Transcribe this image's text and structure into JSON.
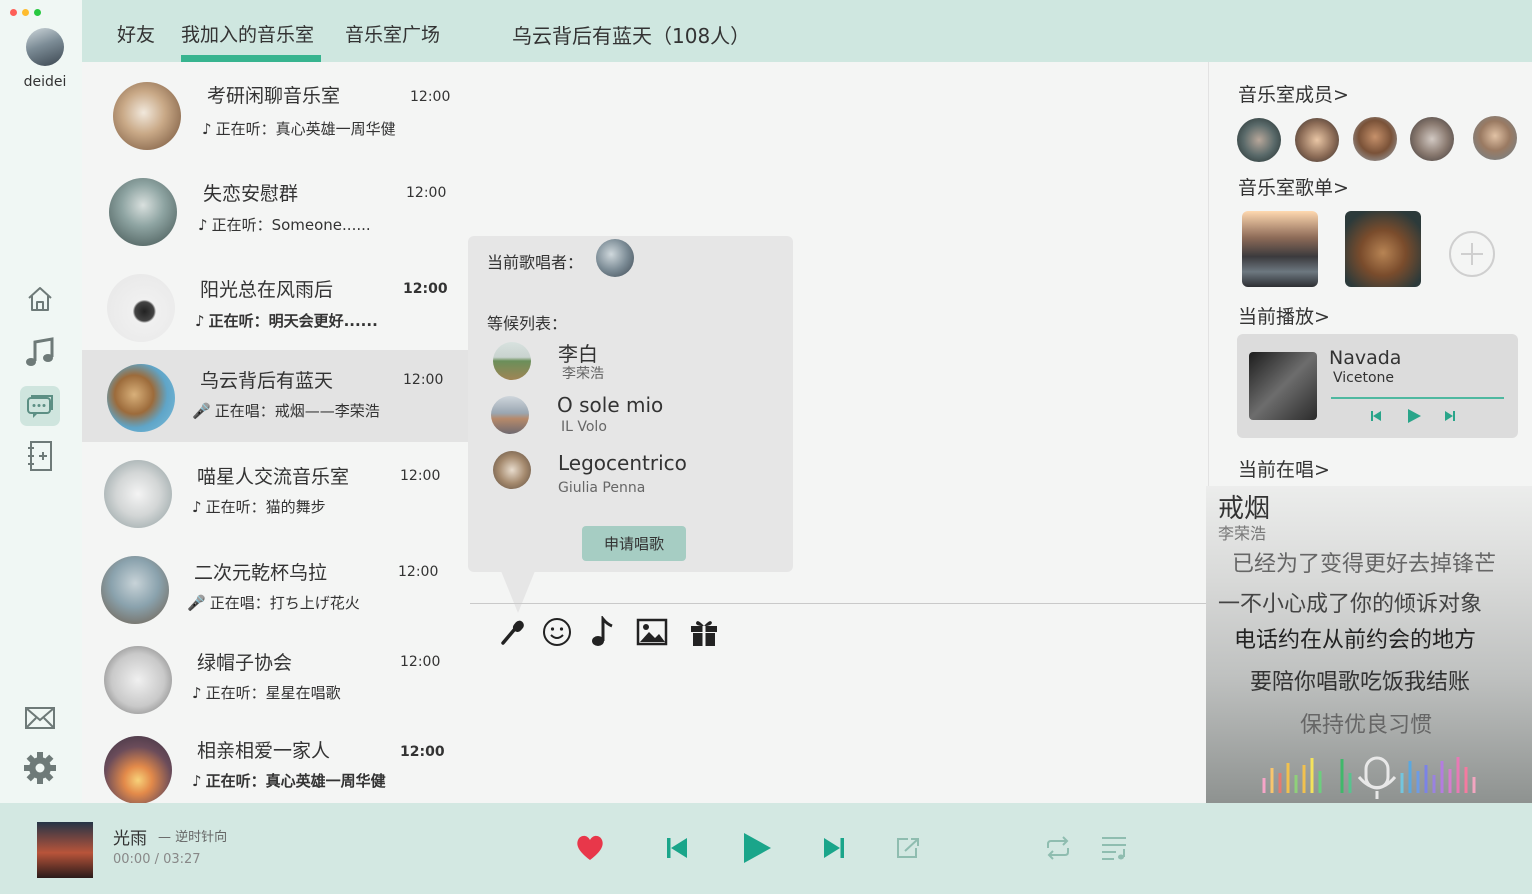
{
  "user": {
    "name": "deidei"
  },
  "tabs": {
    "friends": "好友",
    "joined": "我加入的音乐室",
    "plaza": "音乐室广场"
  },
  "room_title": "乌云背后有蓝天（108人）",
  "rooms": [
    {
      "name": "考研闲聊音乐室",
      "time": "12:00",
      "status": "正在听：真心英雄一周华健",
      "mode": "listen"
    },
    {
      "name": "失恋安慰群",
      "time": "12:00",
      "status": "正在听：Someone......",
      "mode": "listen"
    },
    {
      "name": "阳光总在风雨后",
      "time": "12:00",
      "status": "正在听：明天会更好......",
      "mode": "listen"
    },
    {
      "name": "乌云背后有蓝天",
      "time": "12:00",
      "status": "正在唱：戒烟——李荣浩",
      "mode": "sing"
    },
    {
      "name": "喵星人交流音乐室",
      "time": "12:00",
      "status": "正在听：猫的舞步",
      "mode": "listen"
    },
    {
      "name": "二次元乾杯乌拉",
      "time": "12:00",
      "status": "正在唱：打ち上げ花火",
      "mode": "sing"
    },
    {
      "name": "绿帽子协会",
      "time": "12:00",
      "status": "正在听：星星在唱歌",
      "mode": "listen"
    },
    {
      "name": "相亲相爱一家人",
      "time": "12:00",
      "status": "正在听：真心英雄一周华健",
      "mode": "listen"
    }
  ],
  "queue": {
    "current_label": "当前歌唱者：",
    "waiting_label": "等候列表：",
    "items": [
      {
        "song": "李白",
        "artist": "李荣浩"
      },
      {
        "song": "O sole mio",
        "artist": "IL Volo"
      },
      {
        "song": "Legocentrico",
        "artist": "Giulia Penna"
      }
    ],
    "apply_label": "申请唱歌"
  },
  "side": {
    "members_title": "音乐室成员>",
    "playlist_title": "音乐室歌单>",
    "now_playing_title": "当前播放>",
    "now_singing_title": "当前在唱>",
    "now_playing": {
      "title": "Navada",
      "artist": "Vicetone"
    },
    "now_singing": {
      "title": "戒烟",
      "artist": "李荣浩",
      "lyrics": [
        "已经为了变得更好去掉锋芒",
        "一不小心成了你的倾诉对象",
        "电话约在从前约会的地方",
        "要陪你唱歌吃饭我结账",
        "保持优良习惯"
      ]
    }
  },
  "player": {
    "title": "光雨",
    "subtitle": "— 逆时针向",
    "time": "00:00 / 03:27"
  },
  "colors": {
    "accent": "#37b48f",
    "heart": "#e8374a",
    "topbar": "#cfe7e0"
  },
  "icons": [
    "home-icon",
    "music-note-icon",
    "chat-icon",
    "notebook-icon",
    "mail-icon",
    "gear-icon",
    "microphone-icon",
    "emoji-icon",
    "image-icon",
    "gift-icon",
    "plus-icon",
    "heart-icon",
    "previous-icon",
    "play-icon",
    "next-icon",
    "share-icon",
    "repeat-icon",
    "playlist-icon"
  ]
}
